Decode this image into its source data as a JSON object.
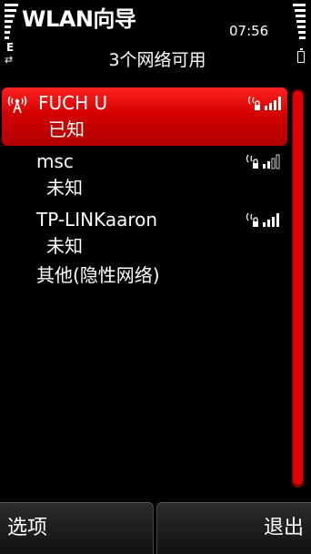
{
  "app": {
    "title": "WLAN向导",
    "time": "07:56"
  },
  "status": {
    "signal_level": 7,
    "battery_level": 7,
    "network_letter": "E"
  },
  "header": {
    "subtitle": "3个网络可用"
  },
  "networks": [
    {
      "name": "FUCH U",
      "status": "已知",
      "selected": true,
      "secured": true,
      "signal": 4
    },
    {
      "name": "msc",
      "status": "未知",
      "selected": false,
      "secured": true,
      "signal": 2
    },
    {
      "name": "TP-LINKaaron",
      "status": "未知",
      "selected": false,
      "secured": true,
      "signal": 4
    }
  ],
  "other_network": {
    "label": "其他(隐性网络)"
  },
  "softkeys": {
    "left": "选项",
    "right": "退出"
  },
  "colors": {
    "accent": "#d40000",
    "scroll_track": "#7a0000",
    "background": "#000000"
  }
}
